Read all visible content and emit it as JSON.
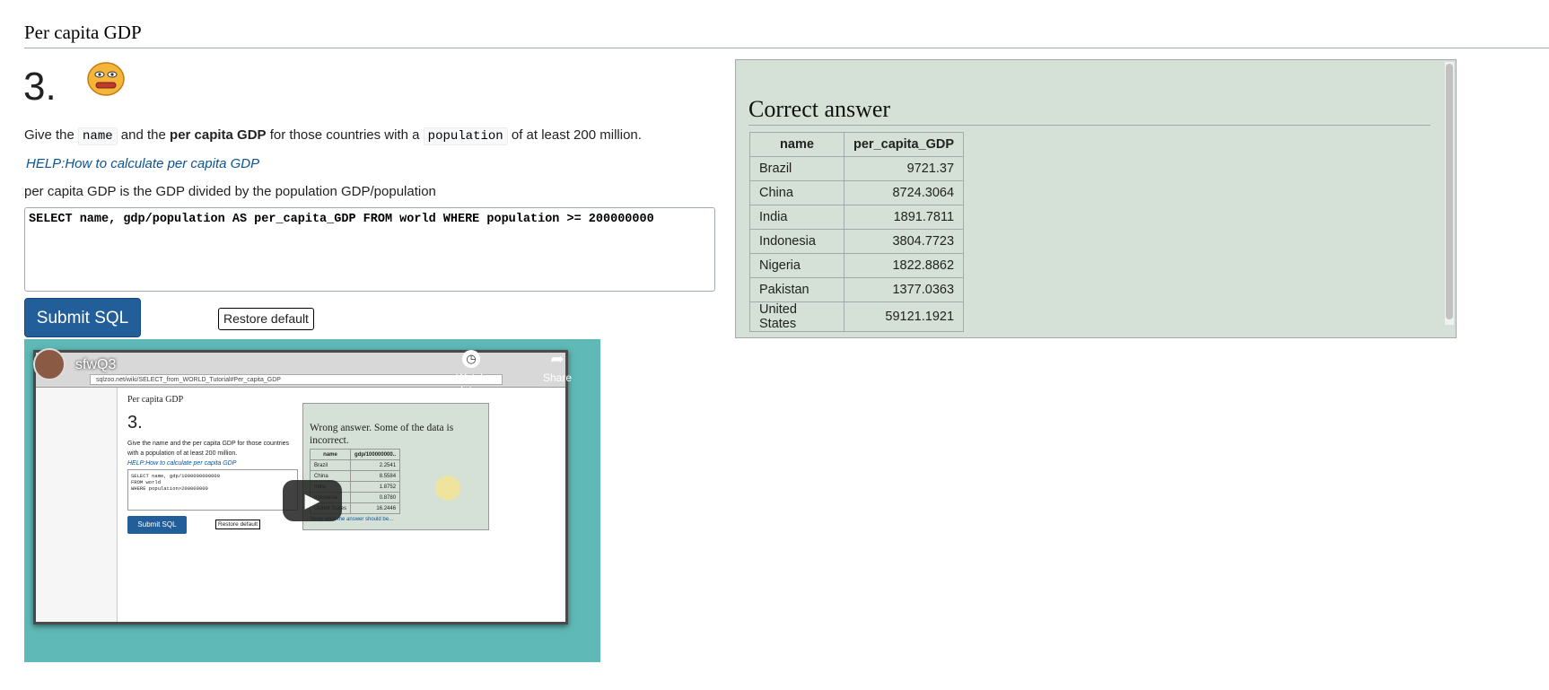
{
  "section_heading": "Per capita GDP",
  "question": {
    "number": "3.",
    "text_part1": "Give the ",
    "code1": "name",
    "text_part2": " and the ",
    "bold": "per capita GDP",
    "text_part3": " for those countries with a ",
    "code2": "population",
    "text_part4": " of at least 200 million.",
    "help_link": "HELP:How to calculate per capita GDP",
    "explanation": "per capita GDP is the GDP divided by the population GDP/population"
  },
  "editor": {
    "sql": "SELECT name, gdp/population AS per_capita_GDP  FROM world WHERE population >= 200000000"
  },
  "buttons": {
    "submit": "Submit SQL",
    "restore": "Restore default"
  },
  "answer": {
    "title": "Correct answer",
    "columns": [
      "name",
      "per_capita_GDP"
    ],
    "rows": [
      [
        "Brazil",
        "9721.37"
      ],
      [
        "China",
        "8724.3064"
      ],
      [
        "India",
        "1891.7811"
      ],
      [
        "Indonesia",
        "3804.7723"
      ],
      [
        "Nigeria",
        "1822.8862"
      ],
      [
        "Pakistan",
        "1377.0363"
      ],
      [
        "United States",
        "59121.1921"
      ]
    ]
  },
  "video": {
    "title": "sfwQ3",
    "watch_later": "Watch later",
    "share": "Share",
    "url": "sqlzoo.net/wiki/SELECT_from_WORLD_Tutorial#Per_capita_GDP",
    "inner_heading": "Per capita GDP",
    "inner_number": "3.",
    "inner_question": "Give the name and the per capita GDP for those countries with a population of at least 200 million.",
    "inner_help": "HELP:How to calculate per capita GDP",
    "inner_sql": "SELECT name, gdp/1000000000000\nFROM world\nWHERE population>200000000",
    "inner_submit": "Submit SQL",
    "inner_restore": "Restore default",
    "inner_result_title": "Wrong answer. Some of the data is incorrect.",
    "inner_columns": [
      "name",
      "gdp/100000000.."
    ],
    "inner_rows": [
      [
        "Brazil",
        "2.2541"
      ],
      [
        "China",
        "8.5584"
      ],
      [
        "India",
        "1.8752"
      ],
      [
        "Indonesia",
        "0.8780"
      ],
      [
        "United States",
        "16.2446"
      ]
    ],
    "inner_show_answer": "Show what the answer should be..."
  },
  "icon_names": {
    "smiley": "smiley-face-icon",
    "play": "play-icon",
    "clock": "clock-icon",
    "share": "share-icon"
  }
}
